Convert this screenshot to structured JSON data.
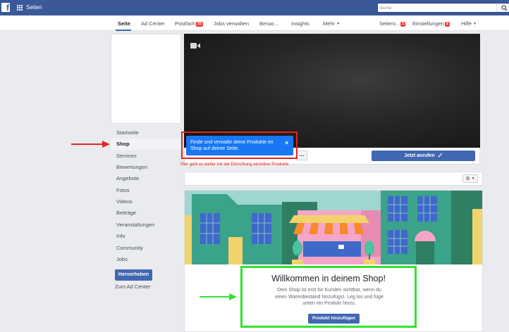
{
  "topbar": {
    "logo": "f",
    "title": "Seiten",
    "search_placeholder": "Suche"
  },
  "nav": {
    "seite": "Seite",
    "ad_center": "Ad Center",
    "postfach": "Postfach",
    "postfach_badge": "21",
    "jobs": "Jobs verwalten",
    "benachrichtigungen": "Benac...",
    "insights": "Insights",
    "mehr": "Mehr",
    "seiteninfo": "Seiteni...",
    "seiteninfo_badge": "1",
    "einstellungen": "Einstellungen",
    "einstellungen_badge": "2",
    "hilfe": "Hilfe"
  },
  "sidebar": {
    "items": [
      "Startseite",
      "Shop",
      "Services",
      "Bewertungen",
      "Angebote",
      "Fotos",
      "Videos",
      "Beiträge",
      "Veranstaltungen",
      "Info",
      "Community",
      "Jobs"
    ],
    "promote_label": "Hervorheben",
    "ad_center_label": "Zum Ad Center"
  },
  "cover": {
    "more_label": "...",
    "call_label": "Jetzt anrufen"
  },
  "tooltip": {
    "text": "Finde und verwalte deine Produkte im Shop auf deiner Seite.",
    "close": "×"
  },
  "annotations": {
    "red_note": "Hier geht es weiter mit der Einrichtung einzelner Produkte"
  },
  "shop": {
    "welcome_title": "Willkommen in deinem Shop!",
    "welcome_text": "Dein Shop ist erst für Kunden sichtbar, wenn du einen Warenbestand hinzufügst. Leg los und füge unten ein Produkt hinzu.",
    "add_product_label": "Produkt hinzufügen"
  },
  "colors": {
    "brand": "#3b5998",
    "button": "#4267b2",
    "tooltip": "#1877f2",
    "annotation_red": "#e8231d",
    "annotation_green": "#35e02f"
  },
  "icons": [
    "facebook-logo-icon",
    "grid-icon",
    "search-icon",
    "camera-icon",
    "pencil-icon",
    "gear-icon",
    "close-icon",
    "red-arrow-icon",
    "green-arrow-icon"
  ]
}
